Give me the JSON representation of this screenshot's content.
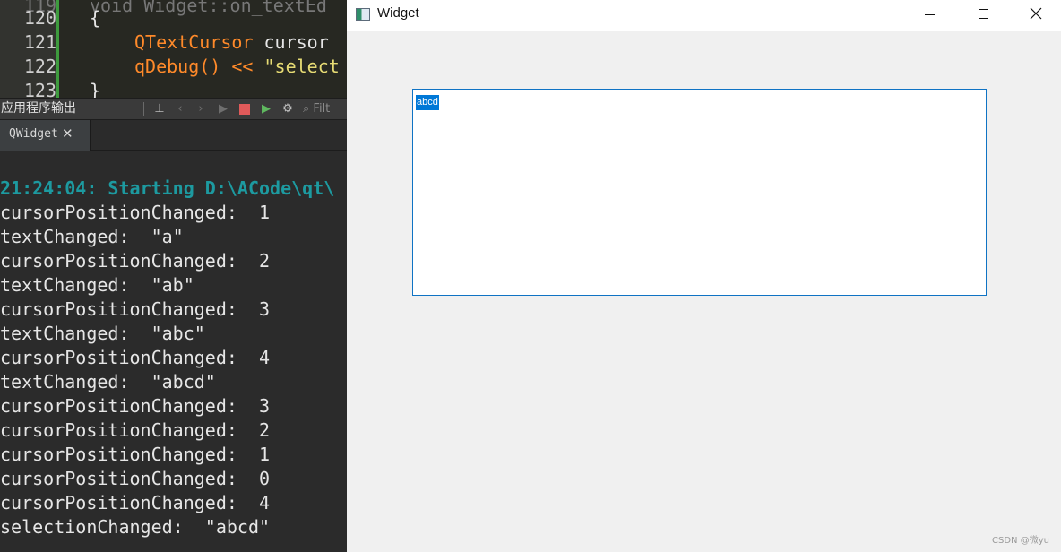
{
  "ide": {
    "code_lines": [
      {
        "num": "120",
        "text": "{"
      },
      {
        "num": "121",
        "type": "QTextCursor",
        "rest": " cursor"
      },
      {
        "num": "122",
        "func": "qDebug() << ",
        "str": "\"select"
      },
      {
        "num": "123",
        "text": "}"
      }
    ],
    "output_panel": {
      "title": "应用程序输出",
      "filter_placeholder": "Filt",
      "tab_label": "QWidget",
      "tab_close": "✕"
    },
    "output_lines": [
      "21:24:04: Starting D:\\ACode\\qt\\",
      "cursorPositionChanged:  1",
      "textChanged:  \"a\"",
      "cursorPositionChanged:  2",
      "textChanged:  \"ab\"",
      "cursorPositionChanged:  3",
      "textChanged:  \"abc\"",
      "cursorPositionChanged:  4",
      "textChanged:  \"abcd\"",
      "cursorPositionChanged:  3",
      "cursorPositionChanged:  2",
      "cursorPositionChanged:  1",
      "cursorPositionChanged:  0",
      "cursorPositionChanged:  4",
      "selectionChanged:  \"abcd\""
    ]
  },
  "window": {
    "title": "Widget",
    "text_edit_value": "abcd"
  },
  "watermark": "CSDN @微yu",
  "colors": {
    "selection": "#0078d7",
    "start_line": "#1d9aa0",
    "editor_border": "#0f73c4"
  }
}
